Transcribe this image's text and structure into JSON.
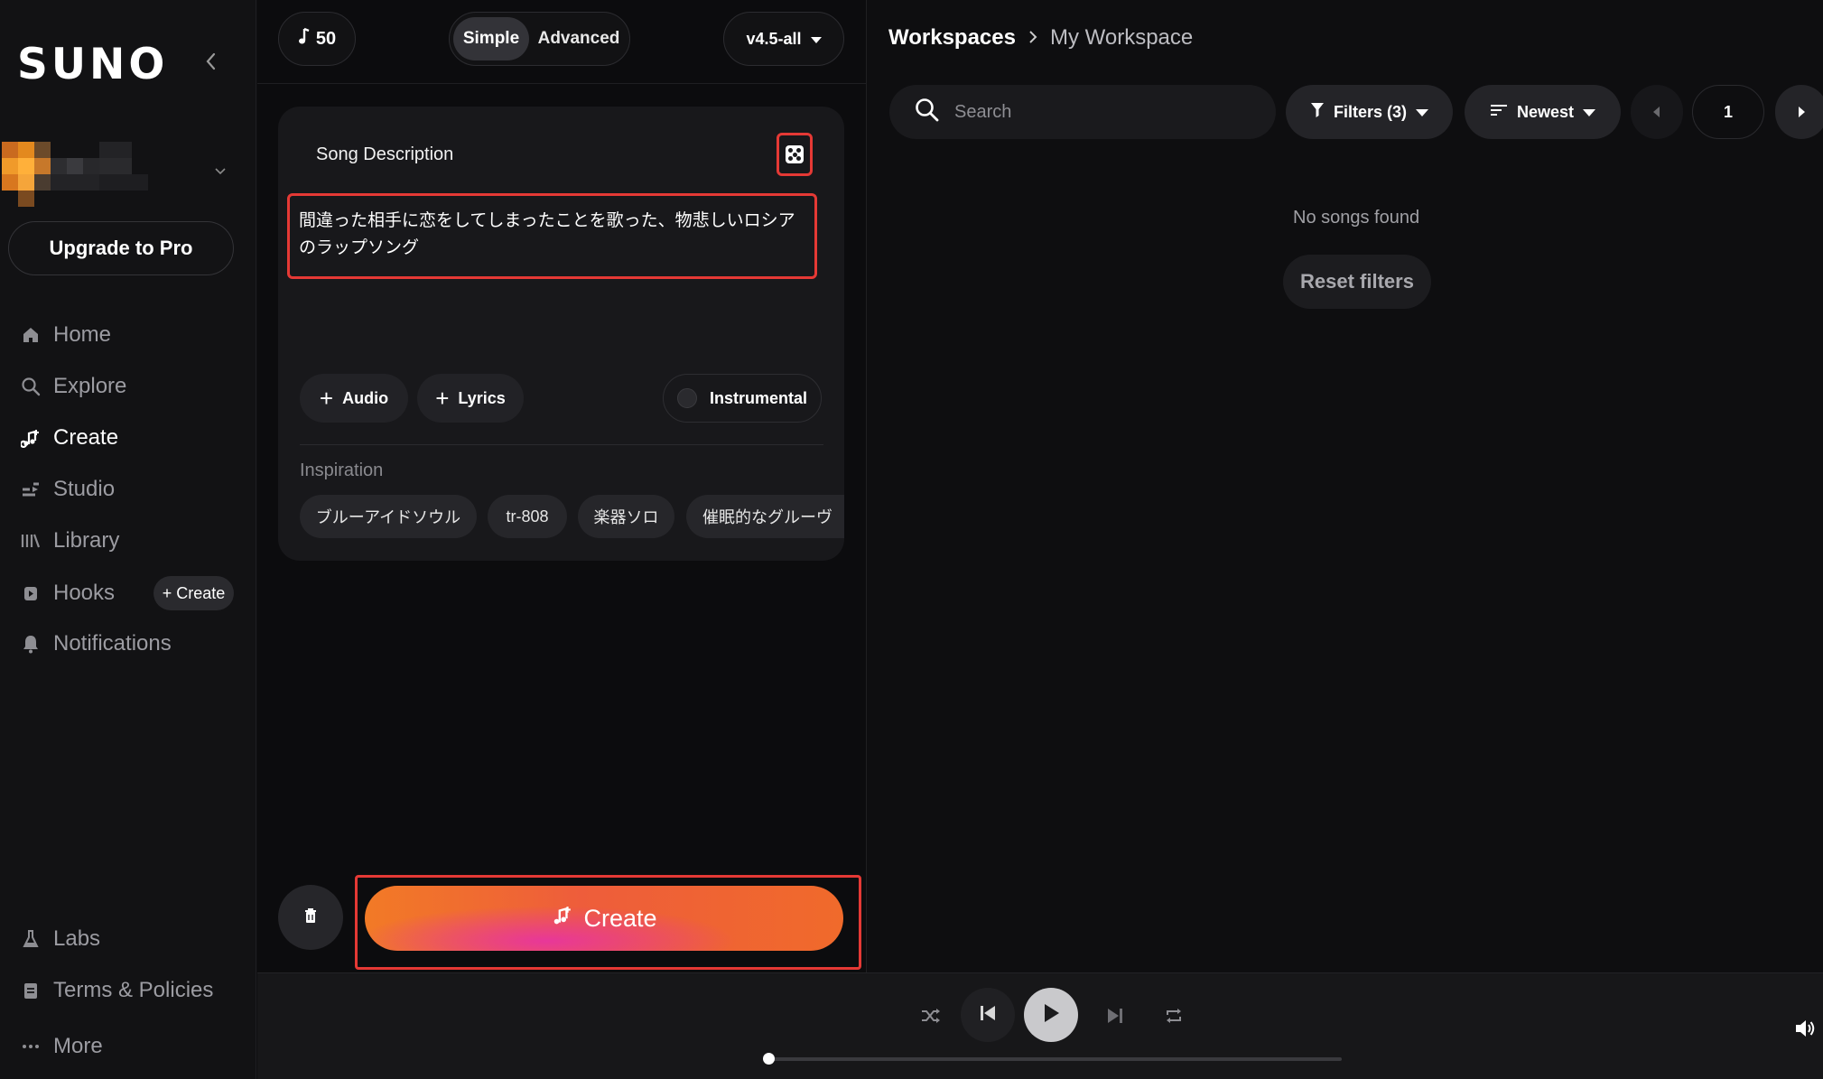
{
  "sidebar": {
    "logo": "SUNO",
    "upgrade_label": "Upgrade to Pro",
    "items": [
      {
        "label": "Home",
        "icon": "home-icon"
      },
      {
        "label": "Explore",
        "icon": "search-icon"
      },
      {
        "label": "Create",
        "icon": "music-plus-icon",
        "active": true
      },
      {
        "label": "Studio",
        "icon": "studio-icon"
      },
      {
        "label": "Library",
        "icon": "library-icon"
      },
      {
        "label": "Hooks",
        "icon": "hooks-icon"
      },
      {
        "label": "Notifications",
        "icon": "bell-icon"
      }
    ],
    "hooks_create_label": "+ Create",
    "bottom_items": [
      {
        "label": "Labs",
        "icon": "flask-icon"
      },
      {
        "label": "Terms & Policies",
        "icon": "document-icon"
      },
      {
        "label": "More",
        "icon": "more-icon"
      }
    ]
  },
  "create_panel": {
    "credits": "50",
    "modes": [
      "Simple",
      "Advanced"
    ],
    "selected_mode": "Simple",
    "version": "v4.5-all",
    "song_description_label": "Song Description",
    "song_description_value": "間違った相手に恋をしてしまったことを歌った、物悲しいロシアのラップソング",
    "audio_label": "Audio",
    "lyrics_label": "Lyrics",
    "instrumental_label": "Instrumental",
    "inspiration_label": "Inspiration",
    "inspiration_tags": [
      "ブルーアイドソウル",
      "tr-808",
      "楽器ソロ",
      "催眠的なグルーヴ"
    ],
    "create_label": "Create"
  },
  "workspace": {
    "breadcrumb_root": "Workspaces",
    "breadcrumb_current": "My Workspace",
    "search_placeholder": "Search",
    "filters_label": "Filters (3)",
    "sort_label": "Newest",
    "page": "1",
    "empty_text": "No songs found",
    "reset_label": "Reset filters"
  },
  "player": {
    "progress": 0
  },
  "colors": {
    "accent_orange": "#f27a26",
    "accent_pink": "#e8379a",
    "highlight_red": "#e53935"
  }
}
